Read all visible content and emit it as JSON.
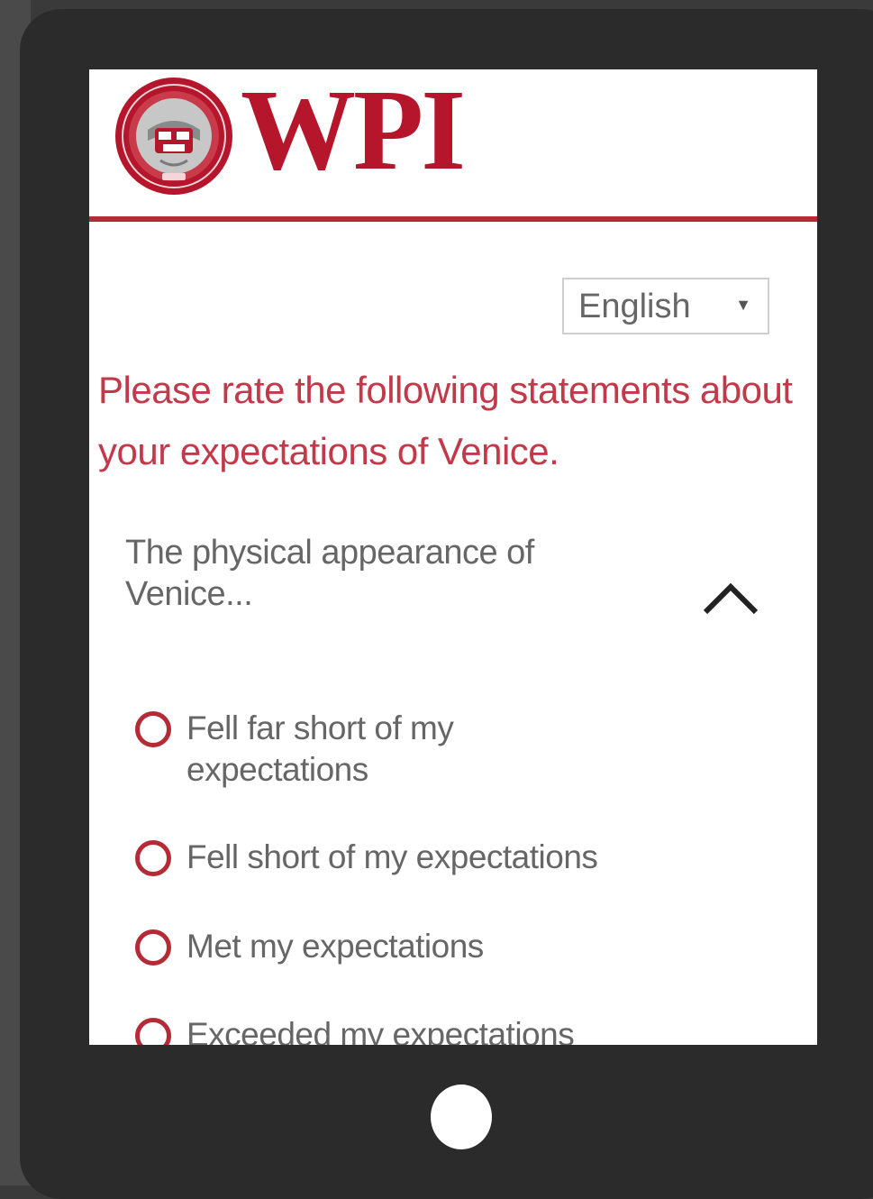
{
  "header": {
    "brand": "WPI",
    "seal_icon": "wpi-seal-logo-icon",
    "brand_color": "#b5162b",
    "rule_color": "#b42a35"
  },
  "language_selector": {
    "selected": "English",
    "caret_icon": "dropdown-caret-icon"
  },
  "survey": {
    "prompt": "Please rate the following statements about your expectations of Venice.",
    "question": "The physical appearance of Venice...",
    "collapse_icon": "chevron-up-icon",
    "options": [
      "Fell far short of my expectations",
      "Fell short of my expectations",
      "Met my expectations",
      "Exceeded my expectations"
    ]
  },
  "device": {
    "home_button_icon": "home-button-icon"
  }
}
